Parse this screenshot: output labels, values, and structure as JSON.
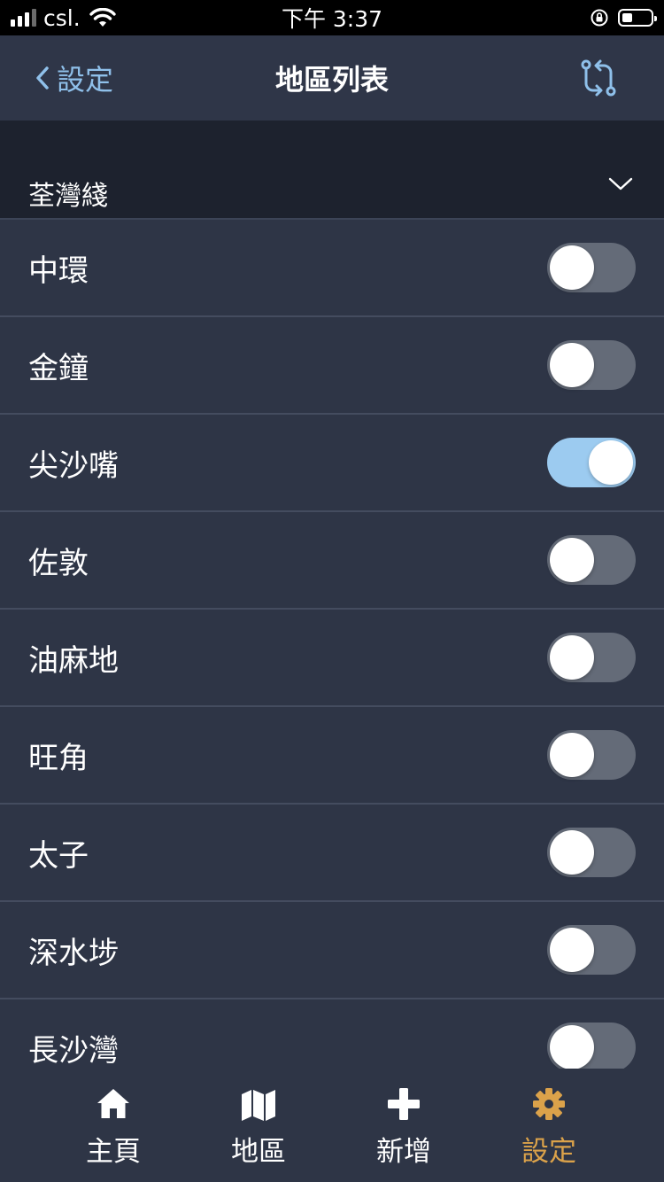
{
  "status_bar": {
    "carrier": "csl.",
    "time": "下午 3:37"
  },
  "nav": {
    "back_label": "設定",
    "title": "地區列表",
    "back_icon": "chevron-left-icon",
    "action_icon": "swap-icon"
  },
  "section": {
    "title": "荃灣綫",
    "icon": "chevron-down-icon"
  },
  "stations": [
    {
      "label": "中環",
      "enabled": false
    },
    {
      "label": "金鐘",
      "enabled": false
    },
    {
      "label": "尖沙嘴",
      "enabled": true
    },
    {
      "label": "佐敦",
      "enabled": false
    },
    {
      "label": "油麻地",
      "enabled": false
    },
    {
      "label": "旺角",
      "enabled": false
    },
    {
      "label": "太子",
      "enabled": false
    },
    {
      "label": "深水埗",
      "enabled": false
    },
    {
      "label": "長沙灣",
      "enabled": false
    }
  ],
  "tabs": [
    {
      "label": "主頁",
      "icon": "home-icon",
      "active": false
    },
    {
      "label": "地區",
      "icon": "map-icon",
      "active": false
    },
    {
      "label": "新增",
      "icon": "plus-icon",
      "active": false
    },
    {
      "label": "設定",
      "icon": "gear-icon",
      "active": true
    }
  ],
  "colors": {
    "background": "#2e3546",
    "section_background": "#1d222e",
    "link": "#8fc0ea",
    "toggle_on": "#9ccbf0",
    "toggle_off": "#646b78",
    "tab_active": "#dba24a"
  }
}
